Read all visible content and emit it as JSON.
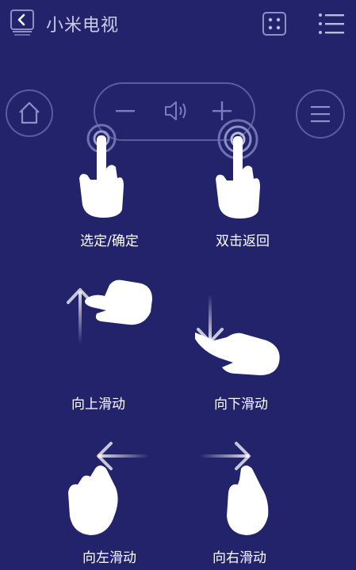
{
  "header": {
    "title": "小米电视",
    "back_icon": "back-arrow-icon",
    "dice_icon": "dice-icon",
    "menu_icon": "list-menu-icon"
  },
  "controls": {
    "home_icon": "home-icon",
    "volume_minus": "−",
    "volume_icon": "speaker-icon",
    "volume_plus": "+",
    "list_icon": "hamburger-icon"
  },
  "gestures": [
    {
      "label": "选定/确定"
    },
    {
      "label": "双击返回"
    },
    {
      "label": "向上滑动"
    },
    {
      "label": "向下滑动"
    },
    {
      "label": "向左滑动"
    },
    {
      "label": "向右滑动"
    }
  ],
  "colors": {
    "background": "#23236b",
    "outline": "#5a5ca0",
    "text": "#ffffff"
  }
}
